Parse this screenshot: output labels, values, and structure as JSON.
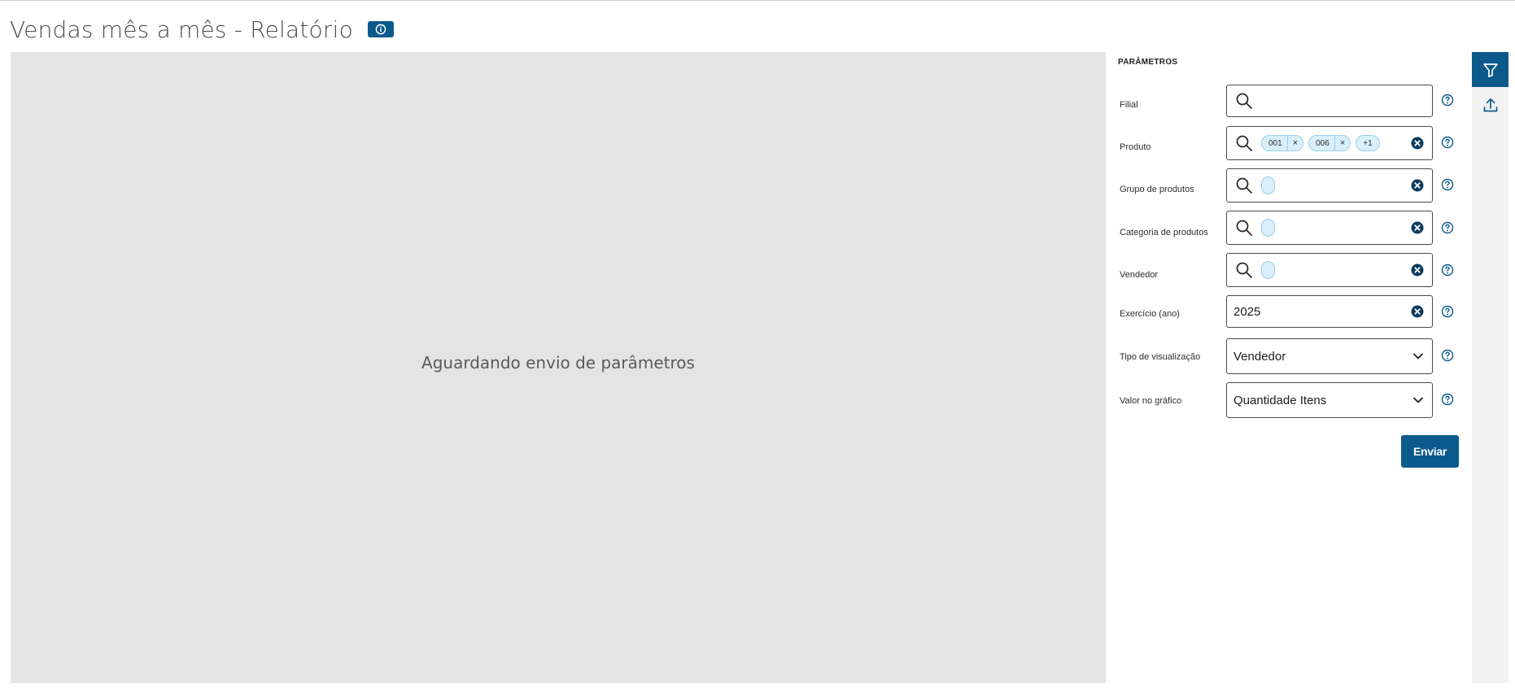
{
  "page": {
    "title": "Vendas mês a mês - Relatório",
    "info_icon": "info-icon"
  },
  "preview": {
    "message": "Aguardando envio de parâmetros"
  },
  "params": {
    "title": "PARÂMETROS",
    "fields": [
      {
        "label": "Filial",
        "type": "lookup",
        "chips": []
      },
      {
        "label": "Produto",
        "type": "lookup",
        "chips": [
          "001",
          "006"
        ],
        "more": "+1"
      },
      {
        "label": "Grupo de produtos",
        "type": "lookup",
        "chips": []
      },
      {
        "label": "Categoria de produtos",
        "type": "lookup",
        "chips": []
      },
      {
        "label": "Vendedor",
        "type": "lookup",
        "chips": []
      },
      {
        "label": "Exercício (ano)",
        "type": "number",
        "value": "2025"
      },
      {
        "label": "Tipo de visualização",
        "type": "select",
        "value": "Vendedor"
      },
      {
        "label": "Valor no gráfico",
        "type": "select",
        "value": "Quantidade Itens"
      }
    ],
    "submit_label": "Enviar"
  },
  "rail": {
    "items": [
      {
        "icon": "filter-icon",
        "active": true
      },
      {
        "icon": "upload-icon",
        "active": false
      }
    ]
  },
  "colors": {
    "primary": "#0c5a8c",
    "preview_bg": "#e4e4e4",
    "chip_bg": "#d9effb"
  }
}
